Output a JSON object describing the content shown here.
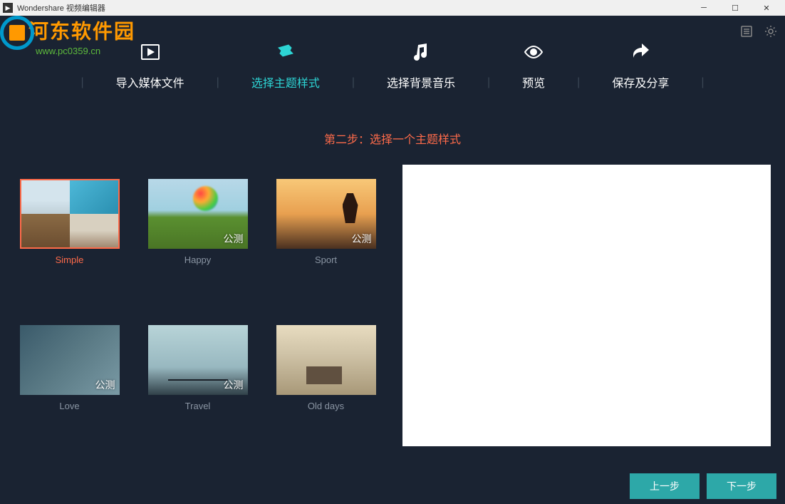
{
  "titlebar": {
    "title": "Wondershare 视频编辑器"
  },
  "watermark": {
    "brand": "河东软件园",
    "url": "www.pc0359.cn"
  },
  "nav": {
    "items": [
      {
        "label": "导入媒体文件",
        "icon": "import"
      },
      {
        "label": "选择主题样式",
        "icon": "theme"
      },
      {
        "label": "选择背景音乐",
        "icon": "music"
      },
      {
        "label": "预览",
        "icon": "preview"
      },
      {
        "label": "保存及分享",
        "icon": "share"
      }
    ]
  },
  "step_title": "第二步：选择一个主题样式",
  "themes": [
    {
      "label": "Simple",
      "beta": false,
      "selected": true
    },
    {
      "label": "Happy",
      "beta": true,
      "selected": false
    },
    {
      "label": "Sport",
      "beta": true,
      "selected": false
    },
    {
      "label": "Love",
      "beta": true,
      "selected": false
    },
    {
      "label": "Travel",
      "beta": true,
      "selected": false
    },
    {
      "label": "Old days",
      "beta": false,
      "selected": false
    }
  ],
  "beta_label": "公测",
  "buttons": {
    "prev": "上一步",
    "next": "下一步"
  }
}
